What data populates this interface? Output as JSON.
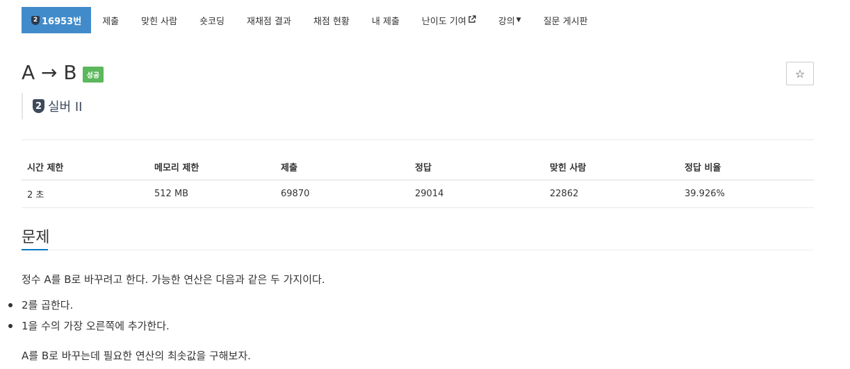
{
  "nav": {
    "problem_tier_glyph": "2",
    "problem_number": "16953번",
    "items": [
      {
        "label": "제출"
      },
      {
        "label": "맞힌 사람"
      },
      {
        "label": "숏코딩"
      },
      {
        "label": "재채점 결과"
      },
      {
        "label": "채점 현황"
      },
      {
        "label": "내 제출"
      },
      {
        "label": "난이도 기여",
        "icon": "external-link-icon"
      },
      {
        "label": "강의",
        "icon": "caret-down-icon"
      },
      {
        "label": "질문 게시판"
      }
    ]
  },
  "problem": {
    "title": "A → B",
    "status": "성공",
    "status_color": "#5cb85c",
    "tier_glyph": "2",
    "tier_name": "실버 II",
    "star_icon": "☆"
  },
  "stats": {
    "headers": [
      "시간 제한",
      "메모리 제한",
      "제출",
      "정답",
      "맞힌 사람",
      "정답 비율"
    ],
    "values": [
      "2 초",
      "512 MB",
      "69870",
      "29014",
      "22862",
      "39.926%"
    ]
  },
  "section": {
    "title": "문제",
    "description": "정수 A를 B로 바꾸려고 한다. 가능한 연산은 다음과 같은 두 가지이다.",
    "operations": [
      "2를 곱한다.",
      "1을 수의 가장 오른쪽에 추가한다."
    ],
    "goal": "A를 B로 바꾸는데 필요한 연산의 최솟값을 구해보자."
  },
  "colors": {
    "nav_active": "#428bca",
    "tier_badge": "#3d4a5c",
    "section_accent": "#0076c0"
  }
}
